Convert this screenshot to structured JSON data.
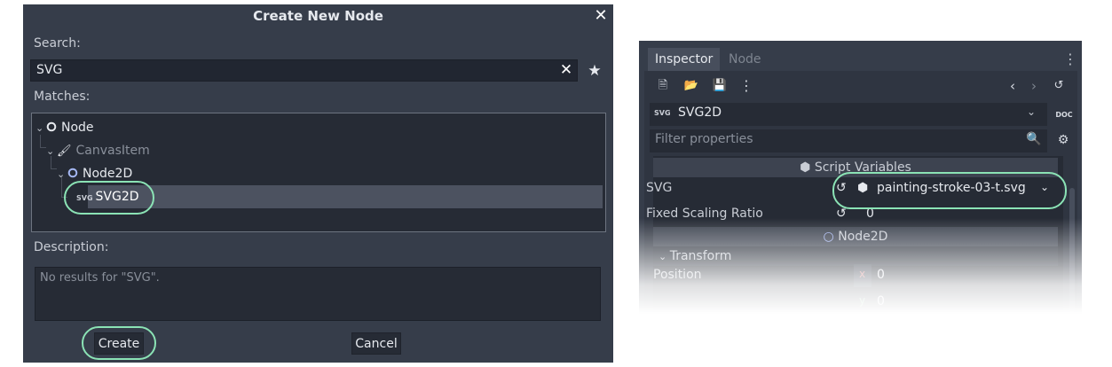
{
  "dialog": {
    "title": "Create New Node",
    "close_icon": "close-icon",
    "search_label": "Search:",
    "search_value": "SVG",
    "matches_label": "Matches:",
    "tree": [
      {
        "label": "Node",
        "icon": "node-circle-icon",
        "color": "#e6e9ee"
      },
      {
        "label": "CanvasItem",
        "icon": "brush-icon",
        "color": "#8a909b"
      },
      {
        "label": "Node2D",
        "icon": "node2d-circle-icon",
        "color": "#a5b7f3"
      },
      {
        "label": "SVG2D",
        "icon": "svg-icon",
        "badge": "SVG",
        "selected": true
      }
    ],
    "description_label": "Description:",
    "description_text": "No results for \"SVG\".",
    "create_label": "Create",
    "cancel_label": "Cancel"
  },
  "inspector": {
    "tabs": [
      {
        "label": "Inspector",
        "active": true
      },
      {
        "label": "Node",
        "active": false
      }
    ],
    "object_name": "SVG2D",
    "object_badge": "SVG",
    "doc_badge": "DOC",
    "filter_placeholder": "Filter properties",
    "sections": {
      "script_variables": "Script Variables",
      "node2d": "Node2D"
    },
    "properties": [
      {
        "name": "SVG",
        "value": "painting-stroke-03-t.svg"
      },
      {
        "name": "Fixed Scaling Ratio",
        "value": "0"
      }
    ],
    "transform_label": "Transform",
    "position_label": "Position",
    "position_x_axis": "x",
    "position_x": "0",
    "position_y_axis": "y",
    "position_y": "0"
  },
  "colors": {
    "panel_bg": "#363d4a",
    "field_bg": "#262b35",
    "highlight_outline": "#8be3b5",
    "node2d_accent": "#a5b7f3"
  }
}
